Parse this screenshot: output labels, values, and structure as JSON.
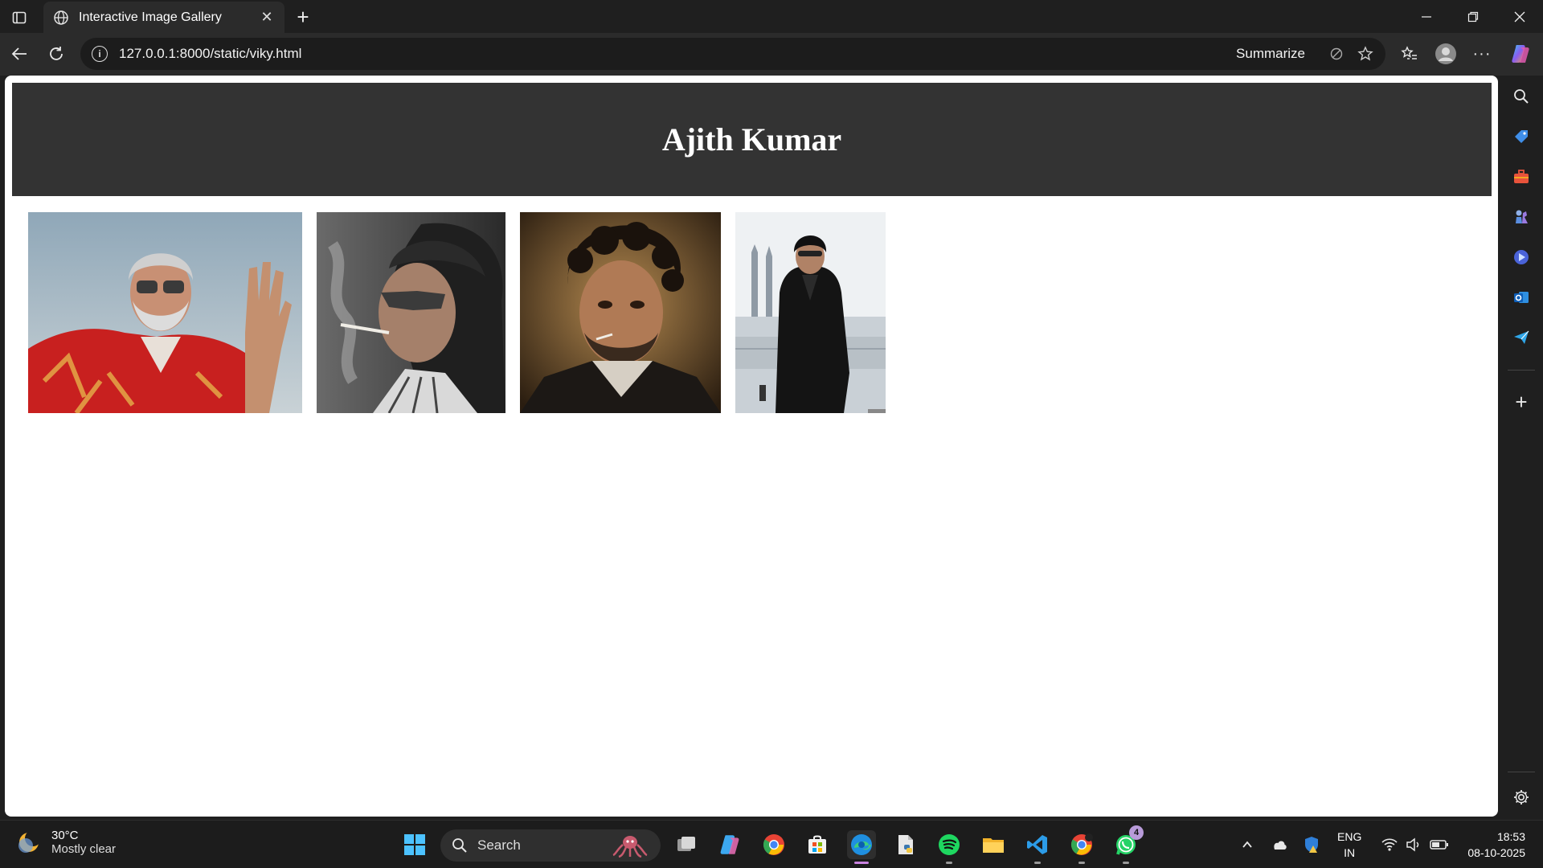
{
  "browser": {
    "tab_title": "Interactive Image Gallery",
    "url": "127.0.0.1:8000/static/viky.html",
    "summarize_label": "Summarize"
  },
  "page": {
    "title": "Ajith Kumar",
    "photos": [
      {
        "name": "photo-1",
        "description_icon": "portrait-red-shirt"
      },
      {
        "name": "photo-2",
        "description_icon": "portrait-sunglasses-smoke"
      },
      {
        "name": "photo-3",
        "description_icon": "portrait-painted"
      },
      {
        "name": "photo-4",
        "description_icon": "portrait-black-suit-city"
      }
    ]
  },
  "taskbar": {
    "weather_temp": "30°C",
    "weather_cond": "Mostly clear",
    "search_label": "Search",
    "lang_top": "ENG",
    "lang_bottom": "IN",
    "time": "18:53",
    "date": "08-10-2025",
    "whatsapp_badge": "4"
  },
  "colors": {
    "header_bg": "#333333",
    "page_bg": "#ffffff",
    "chrome_bg": "#1f1f1f"
  }
}
